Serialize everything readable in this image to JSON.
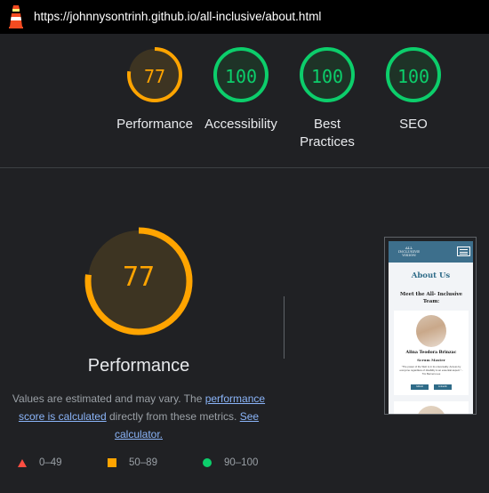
{
  "browser": {
    "url": "https://johnnysontrinh.github.io/all-inclusive/about.html",
    "logo_icon": "lighthouse-icon"
  },
  "summary_scores": [
    {
      "label": "Performance",
      "score": "77",
      "value": 77,
      "color": "#ffa400",
      "track": "#3d3422"
    },
    {
      "label": "Accessibility",
      "score": "100",
      "value": 100,
      "color": "#0cce6b",
      "track": "#1e3327"
    },
    {
      "label": "Best Practices",
      "score": "100",
      "value": 100,
      "color": "#0cce6b",
      "track": "#1e3327"
    },
    {
      "label": "SEO",
      "score": "100",
      "value": 100,
      "color": "#0cce6b",
      "track": "#1e3327"
    }
  ],
  "main": {
    "score": "77",
    "value": 77,
    "label": "Performance",
    "color": "#ffa400",
    "desc_prefix": "Values are estimated and may vary. The ",
    "desc_link1": "performance score is calculated",
    "desc_middle": " directly from these metrics. ",
    "desc_link2": "See calculator."
  },
  "legend": [
    {
      "range": "0–49",
      "shape": "triangle",
      "color": "#ff4e42"
    },
    {
      "range": "50–89",
      "shape": "square",
      "color": "#ffa400"
    },
    {
      "range": "90–100",
      "shape": "circle",
      "color": "#0cce6b"
    }
  ],
  "screenshot": {
    "logo_lines": [
      "ALL",
      "INCLUSIVE",
      "VISION"
    ],
    "menu_icon": "hamburger-menu-icon",
    "title": "About Us",
    "subtitle": "Meet the All- Inclusive Team:",
    "card_name": "Alina Teodora Brinzac",
    "card_role": "Scrum Master",
    "card_quote": "\"The power of the Web is in its universality. Access by everyone regardless of disability is an essential aspect.\" - Tim Berners-Lee",
    "btn1": "GitHub",
    "btn2": "LinkedIn"
  }
}
